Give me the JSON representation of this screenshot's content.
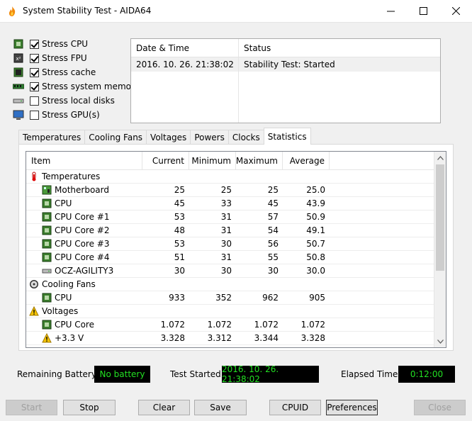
{
  "window": {
    "title": "System Stability Test - AIDA64"
  },
  "stress_options": [
    {
      "label": "Stress CPU",
      "checked": true,
      "icon": "cpu-chip-icon"
    },
    {
      "label": "Stress FPU",
      "checked": true,
      "icon": "fpu-chip-icon"
    },
    {
      "label": "Stress cache",
      "checked": true,
      "icon": "cache-chip-icon"
    },
    {
      "label": "Stress system memory",
      "checked": true,
      "icon": "memory-module-icon"
    },
    {
      "label": "Stress local disks",
      "checked": false,
      "icon": "disk-drive-icon"
    },
    {
      "label": "Stress GPU(s)",
      "checked": false,
      "icon": "monitor-icon"
    }
  ],
  "log": {
    "columns": [
      "Date & Time",
      "Status"
    ],
    "rows": [
      {
        "datetime": "2016. 10. 26. 21:38:02",
        "status": "Stability Test: Started"
      }
    ]
  },
  "tabs": [
    "Temperatures",
    "Cooling Fans",
    "Voltages",
    "Powers",
    "Clocks",
    "Statistics"
  ],
  "active_tab": "Statistics",
  "stats": {
    "columns": [
      "Item",
      "Current",
      "Minimum",
      "Maximum",
      "Average"
    ],
    "rows": [
      {
        "type": "group",
        "icon": "thermometer-icon",
        "item": "Temperatures"
      },
      {
        "type": "child",
        "icon": "motherboard-icon",
        "item": "Motherboard",
        "current": "25",
        "min": "25",
        "max": "25",
        "avg": "25.0"
      },
      {
        "type": "child",
        "icon": "cpu-chip-icon",
        "item": "CPU",
        "current": "45",
        "min": "33",
        "max": "45",
        "avg": "43.9"
      },
      {
        "type": "child",
        "icon": "cpu-chip-icon",
        "item": "CPU Core #1",
        "current": "53",
        "min": "31",
        "max": "57",
        "avg": "50.9"
      },
      {
        "type": "child",
        "icon": "cpu-chip-icon",
        "item": "CPU Core #2",
        "current": "48",
        "min": "31",
        "max": "54",
        "avg": "49.1"
      },
      {
        "type": "child",
        "icon": "cpu-chip-icon",
        "item": "CPU Core #3",
        "current": "53",
        "min": "30",
        "max": "56",
        "avg": "50.7"
      },
      {
        "type": "child",
        "icon": "cpu-chip-icon",
        "item": "CPU Core #4",
        "current": "51",
        "min": "31",
        "max": "55",
        "avg": "50.8"
      },
      {
        "type": "child",
        "icon": "disk-drive-icon",
        "item": "OCZ-AGILITY3",
        "current": "30",
        "min": "30",
        "max": "30",
        "avg": "30.0"
      },
      {
        "type": "group",
        "icon": "fan-icon",
        "item": "Cooling Fans"
      },
      {
        "type": "child",
        "icon": "cpu-chip-icon",
        "item": "CPU",
        "current": "933",
        "min": "352",
        "max": "962",
        "avg": "905"
      },
      {
        "type": "group",
        "icon": "warning-icon",
        "item": "Voltages"
      },
      {
        "type": "child",
        "icon": "cpu-chip-icon",
        "item": "CPU Core",
        "current": "1.072",
        "min": "1.072",
        "max": "1.072",
        "avg": "1.072"
      },
      {
        "type": "child",
        "icon": "warning-icon",
        "item": "+3.3 V",
        "current": "3.328",
        "min": "3.312",
        "max": "3.344",
        "avg": "3.328"
      }
    ]
  },
  "status": {
    "battery_label": "Remaining Battery:",
    "battery_value": "No battery",
    "started_label": "Test Started:",
    "started_value": "2016. 10. 26. 21:38:02",
    "elapsed_label": "Elapsed Time:",
    "elapsed_value": "0:12:00"
  },
  "buttons": {
    "start": "Start",
    "stop": "Stop",
    "clear": "Clear",
    "save": "Save",
    "cpuid": "CPUID",
    "preferences": "Preferences",
    "close": "Close"
  },
  "colors": {
    "lcd_text": "#22e022",
    "lcd_bg": "#000000"
  }
}
